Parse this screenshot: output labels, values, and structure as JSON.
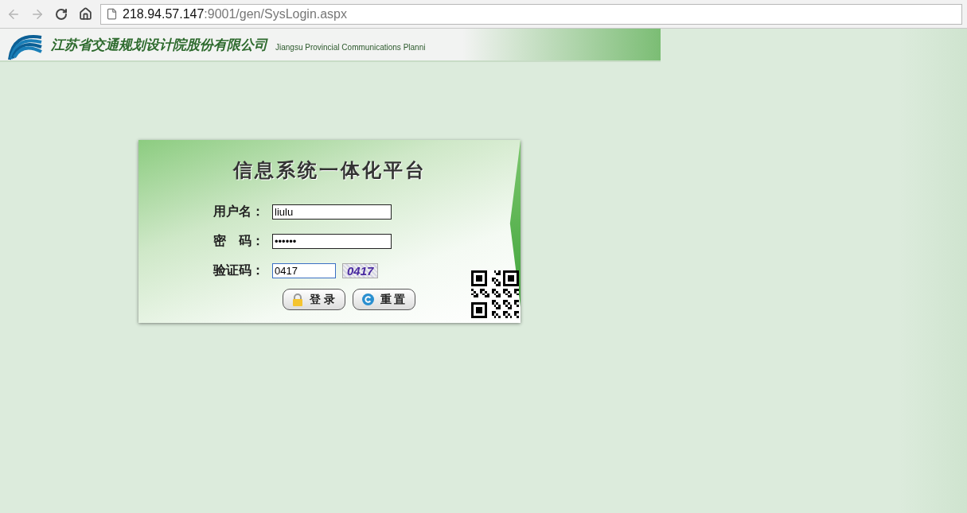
{
  "browser": {
    "address_host": "218.94.57.147",
    "address_rest": ":9001/gen/SysLogin.aspx"
  },
  "banner": {
    "company_cn": "江苏省交通规划设计院股份有限公司",
    "company_en": "Jiangsu Provincial Communications Planni"
  },
  "login": {
    "title": "信息系统一体化平台",
    "fields": [
      {
        "kind": "text",
        "label": "用户名：",
        "value": "liulu",
        "focused": false
      },
      {
        "kind": "password",
        "label": "密　码：",
        "value": "••••••",
        "focused": false
      },
      {
        "kind": "captcha",
        "label": "验证码：",
        "value": "0417",
        "focused": true,
        "captcha_text": "0417"
      }
    ],
    "buttons": [
      {
        "kind": "login",
        "label": "登 录"
      },
      {
        "kind": "reset",
        "label": "重 置"
      }
    ]
  }
}
